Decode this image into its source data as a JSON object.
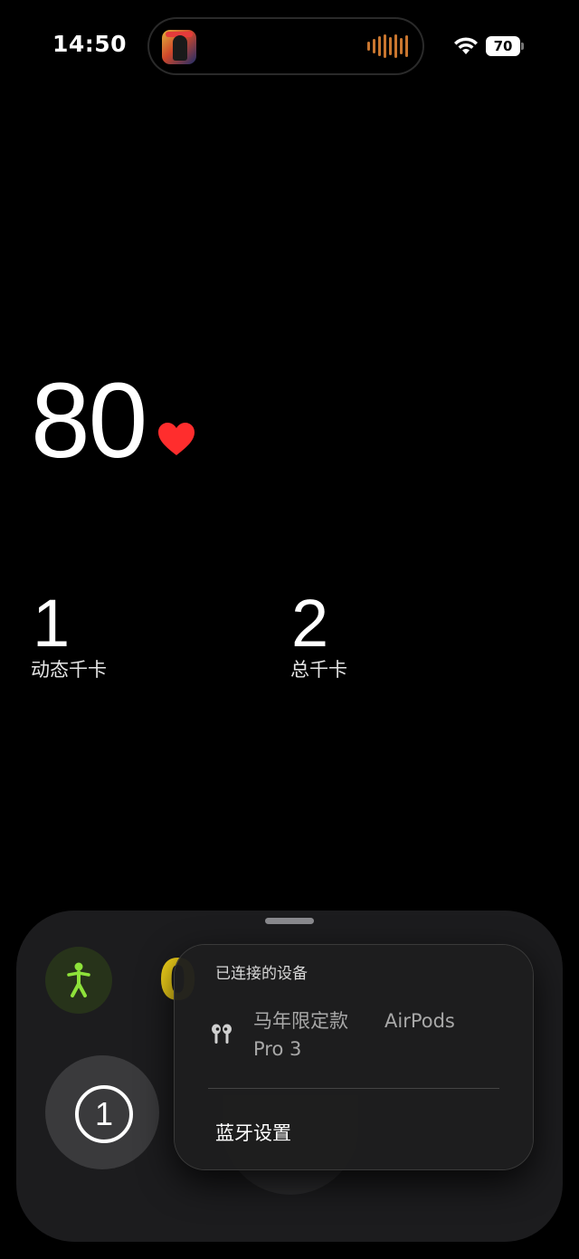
{
  "status_bar": {
    "time": "14:50",
    "battery": "70",
    "icons": [
      "wifi-icon",
      "battery-icon"
    ]
  },
  "live_activity": {
    "album_art_icon": "album-art-icon",
    "waveform_icon": "audio-waveform-icon",
    "accent_color": "#c9762f"
  },
  "heart_rate": {
    "value": "80",
    "icon": "heart-icon",
    "color": "#ff2d2d"
  },
  "stats": {
    "active_calories": {
      "value": "1",
      "label": "动态千卡"
    },
    "total_calories": {
      "value": "2",
      "label": "总千卡"
    }
  },
  "sheet": {
    "activity_icon": "walking-figure-icon",
    "activity_color": "#8ee23a",
    "yellow_number": "0",
    "yellow_color": "#f2d21a",
    "timer_label": "1"
  },
  "popup": {
    "header": "已连接的设备",
    "device": {
      "icon": "earbuds-icon",
      "name_part1": "马年限定款",
      "name_part2": "AirPods",
      "name_part3": "Pro 3"
    },
    "bluetooth_settings": "蓝牙设置"
  }
}
